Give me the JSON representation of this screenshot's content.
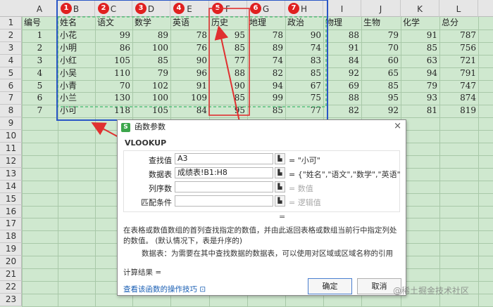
{
  "columns": [
    "A",
    "B",
    "C",
    "D",
    "E",
    "F",
    "G",
    "H",
    "I",
    "J",
    "K",
    "L"
  ],
  "rows": [
    "1",
    "2",
    "3",
    "4",
    "5",
    "6",
    "7",
    "8",
    "9",
    "10",
    "11",
    "12",
    "13",
    "14",
    "15",
    "16",
    "17",
    "18",
    "19",
    "20",
    "21",
    "22",
    "23"
  ],
  "badges": [
    "1",
    "2",
    "3",
    "4",
    "5",
    "6",
    "7"
  ],
  "table": {
    "headers": [
      "编号",
      "姓名",
      "语文",
      "数学",
      "英语",
      "历史",
      "地理",
      "政治",
      "物理",
      "生物",
      "化学",
      "总分"
    ],
    "data": [
      [
        "1",
        "小花",
        "99",
        "89",
        "78",
        "95",
        "78",
        "90",
        "88",
        "79",
        "91",
        "787"
      ],
      [
        "2",
        "小明",
        "86",
        "100",
        "76",
        "85",
        "89",
        "74",
        "91",
        "70",
        "85",
        "756"
      ],
      [
        "3",
        "小红",
        "105",
        "85",
        "90",
        "77",
        "74",
        "83",
        "84",
        "60",
        "63",
        "721"
      ],
      [
        "4",
        "小吴",
        "110",
        "79",
        "96",
        "88",
        "82",
        "85",
        "92",
        "65",
        "94",
        "791"
      ],
      [
        "5",
        "小青",
        "70",
        "102",
        "91",
        "90",
        "94",
        "67",
        "69",
        "85",
        "79",
        "747"
      ],
      [
        "6",
        "小兰",
        "130",
        "100",
        "109",
        "85",
        "99",
        "75",
        "88",
        "95",
        "93",
        "874"
      ],
      [
        "7",
        "小可",
        "118",
        "105",
        "84",
        "95",
        "85",
        "77",
        "82",
        "92",
        "81",
        "819"
      ]
    ]
  },
  "dialog": {
    "title": "函数参数",
    "logo": "S",
    "close": "×",
    "function_name": "VLOOKUP",
    "args": [
      {
        "label": "查找值",
        "value": "A3",
        "result": "= \"小可\"",
        "dim": false
      },
      {
        "label": "数据表",
        "value": "成绩表!B1:H8",
        "result": "= {\"姓名\",\"语文\",\"数学\",\"英语\",\"...",
        "dim": false
      },
      {
        "label": "列序数",
        "value": "",
        "result": "= 数值",
        "dim": true
      },
      {
        "label": "匹配条件",
        "value": "",
        "result": "= 逻辑值",
        "dim": true
      }
    ],
    "ref_icon": "▙",
    "separator": "=",
    "description": "在表格或数值数组的首列查找指定的数值，并由此返回表格或数组当前行中指定列处的数值。 (默认情况下，表是升序的)",
    "arg_help": "数据表：为需要在其中查找数据的数据表，可以使用对区域或区域名称的引用",
    "calc_result": "计算结果 =",
    "help_link": "查看该函数的操作技巧",
    "help_icon": "⊡",
    "ok": "确定",
    "cancel": "取消"
  },
  "watermark": "@稀土掘金技术社区",
  "colors": {
    "sheet_bg": "#cfe8cf",
    "header_bg": "#e6e6e6",
    "badge": "#e02020",
    "blue_box": "#2a56c6",
    "red_box": "#e03030",
    "dashed": "#3fb86a",
    "link": "#1a5fb4"
  }
}
